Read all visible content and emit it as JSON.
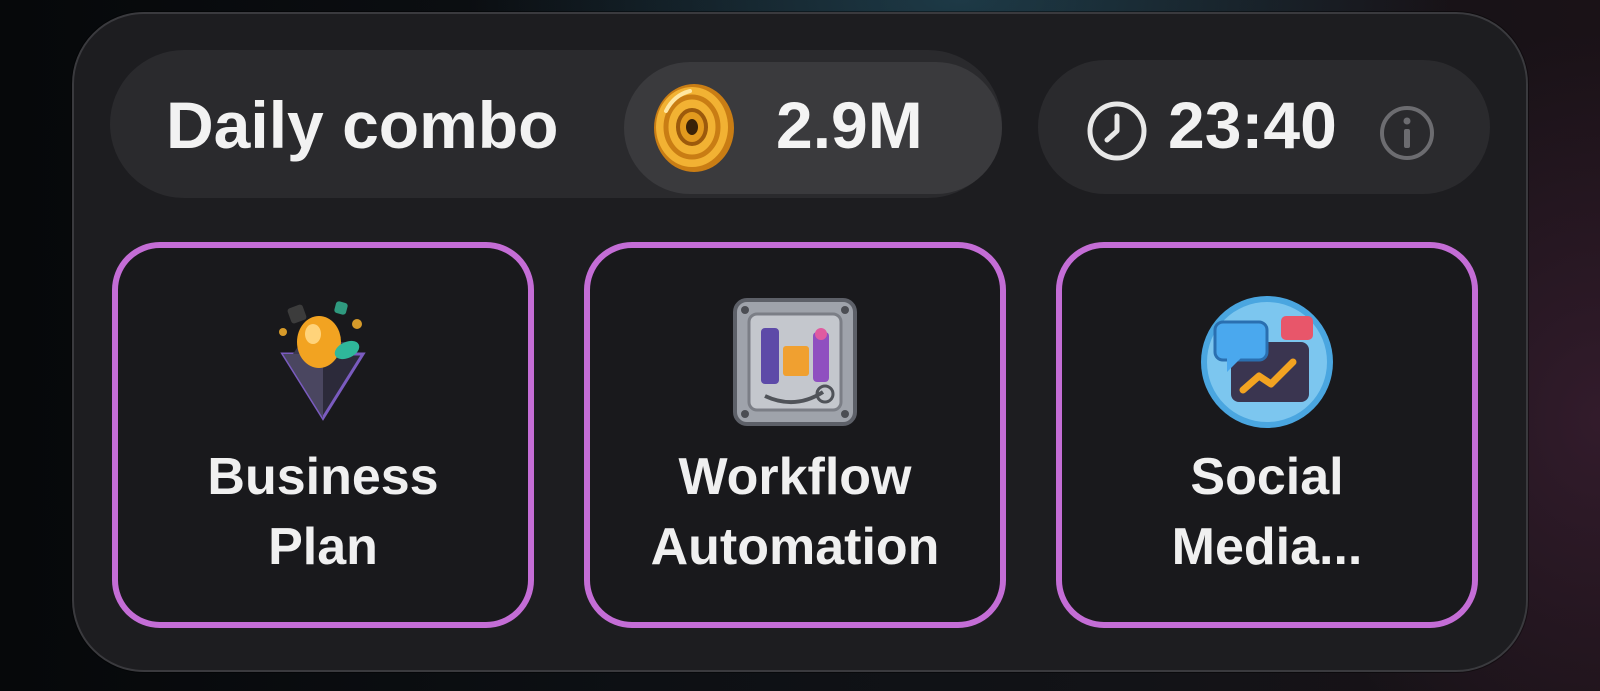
{
  "header": {
    "title": "Daily combo",
    "reward_amount": "2.9M",
    "reward_icon": "coin-icon",
    "timer": "23:40",
    "timer_icon": "clock-icon",
    "info_icon": "info-icon"
  },
  "cards": [
    {
      "line1": "Business",
      "line2": "Plan",
      "icon": "diamond-egg-icon"
    },
    {
      "line1": "Workflow",
      "line2": "Automation",
      "icon": "workflow-machine-icon"
    },
    {
      "line1": "Social",
      "line2": "Media...",
      "icon": "chat-bubbles-chart-icon"
    }
  ],
  "colors": {
    "accent_border": "#c46dd6",
    "card_background": "#1d1d20",
    "pill_background": "#2a2a2d",
    "coin": "#f2b233"
  }
}
